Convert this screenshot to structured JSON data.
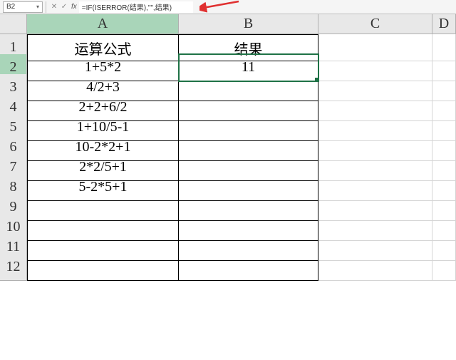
{
  "formula_bar": {
    "cell_ref": "B2",
    "formula": "=IF(ISERROR(结果),\"\",结果)"
  },
  "columns": [
    "A",
    "B",
    "C",
    "D"
  ],
  "row_numbers": [
    "1",
    "2",
    "3",
    "4",
    "5",
    "6",
    "7",
    "8",
    "9",
    "10",
    "11",
    "12"
  ],
  "headers": {
    "A": "运算公式",
    "B": "结果"
  },
  "rows": [
    {
      "A": "1+5*2",
      "B": "11"
    },
    {
      "A": "4/2+3",
      "B": ""
    },
    {
      "A": "2+2+6/2",
      "B": ""
    },
    {
      "A": "1+10/5-1",
      "B": ""
    },
    {
      "A": "10-2*2+1",
      "B": ""
    },
    {
      "A": "2*2/5+1",
      "B": ""
    },
    {
      "A": "5-2*5+1",
      "B": ""
    }
  ],
  "selected_cell": "B2",
  "chart_data": {
    "type": "table",
    "title": "",
    "columns": [
      "运算公式",
      "结果"
    ],
    "data": [
      [
        "1+5*2",
        11
      ],
      [
        "4/2+3",
        null
      ],
      [
        "2+2+6/2",
        null
      ],
      [
        "1+10/5-1",
        null
      ],
      [
        "10-2*2+1",
        null
      ],
      [
        "2*2/5+1",
        null
      ],
      [
        "5-2*5+1",
        null
      ]
    ]
  }
}
